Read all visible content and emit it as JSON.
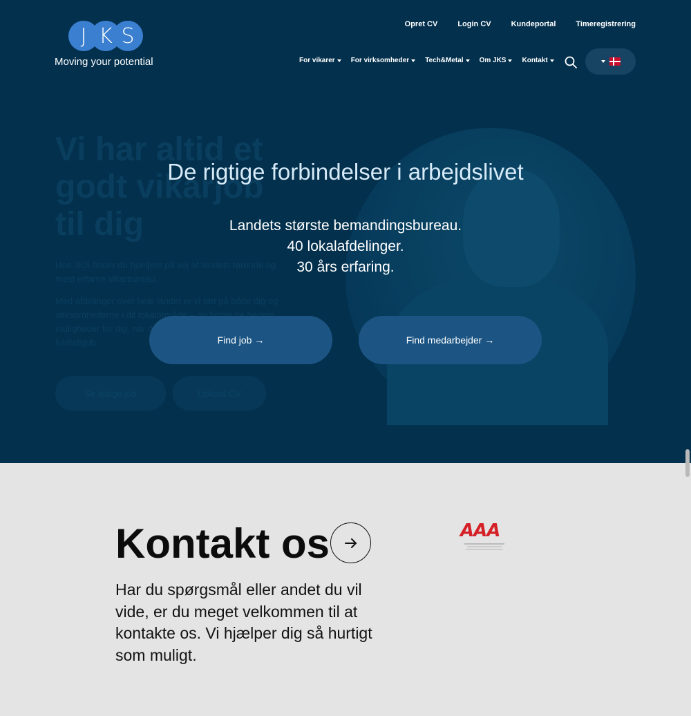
{
  "header": {
    "logo_letters": [
      "J",
      "K",
      "S"
    ],
    "tagline": "Moving your potential",
    "top_links": [
      "Opret CV",
      "Login CV",
      "Kundeportal",
      "Timeregistrering"
    ],
    "nav": [
      "For vikarer",
      "For virksomheder",
      "Tech&Metal",
      "Om JKS",
      "Kontakt"
    ],
    "language_flag": "denmark-flag"
  },
  "hero": {
    "background_heading": "Vi har altid et godt vikarjob til dig",
    "background_paragraph_1": "Hos JKS finder du hjælpen på vej af landets førende og mest erfarne vikarbureau.",
    "background_paragraph_2": "Med afdelinger over hele landet er vi tæt på både dig og virksomhederne i dit lokalområde – og finder de bedste muligheder for dig, når du søger vikariater, deltids- eller fuldtidsjob.",
    "background_btn_1": "Se ledige job",
    "background_btn_2": "Upload CV",
    "title": "De rigtige forbindelser i arbejdslivet",
    "lines": [
      "Landets største bemandingsbureau.",
      "40 lokalafdelinger.",
      "30 års erfaring."
    ],
    "btn_find_job": "Find job →",
    "btn_find_employee": "Find medarbejder →"
  },
  "contact": {
    "title": "Kontakt os",
    "text": "Har du spørgsmål eller andet du vil vide, er du meget velkommen til at kontakte os. Vi hjælper dig så hurtigt som muligt.",
    "badge_text": "AAA"
  },
  "colors": {
    "hero_bg": "#03304d",
    "button_bg": "#1c5584",
    "logo_blue": "#3a7fd0",
    "section_bg": "#e4e4e4",
    "badge_red": "#d62027"
  }
}
